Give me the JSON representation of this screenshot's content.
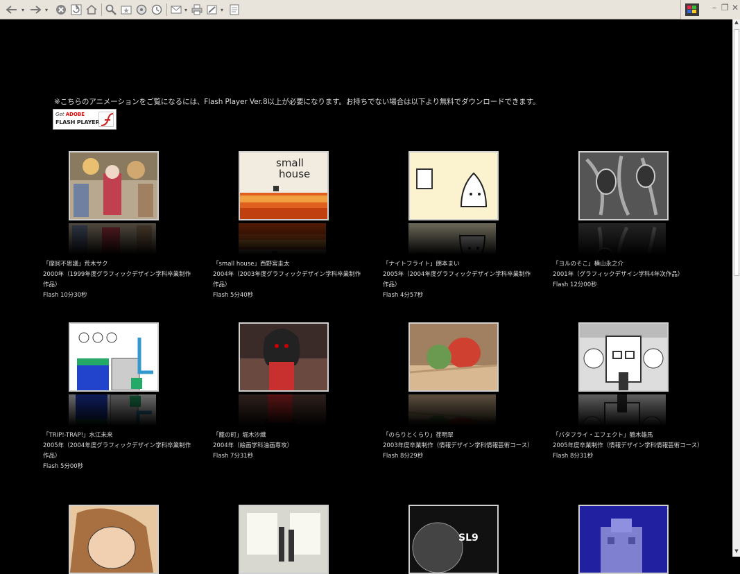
{
  "notice_text": "※こちらのアニメーションをご覧になるには、Flash Player Ver.8以上が必要になります。お持ちでない場合は以下より無料でダウンロードできます。",
  "flash_badge": {
    "get": "Get",
    "adobe": "ADOBE",
    "product": "FLASH PLAYER"
  },
  "items": [
    {
      "title": "「摩訶不思議」荒木サク",
      "year": "2000年（1999年度グラフィックデザイン学科卒業制作作品）",
      "duration": "Flash 10分30秒"
    },
    {
      "title": "「small house」西野宮圭太",
      "year": "2004年（2003年度グラフィックデザイン学科卒業制作作品）",
      "duration": "Flash 5分40秒",
      "thumb_text": "small\nhouse"
    },
    {
      "title": "「ナイトフライト」朗本まい",
      "year": "2005年（2004年度グラフィックデザイン学科卒業制作作品）",
      "duration": "Flash 4分57秒"
    },
    {
      "title": "「ヨルのそこ」横山永之介",
      "year": "2001年（グラフィックデザイン学科4年次作品）",
      "duration": "Flash 12分00秒"
    },
    {
      "title": "「TRIP!-TRAP!」水江未来",
      "year": "2005年（2004年度グラフィックデザイン学科卒業制作作品）",
      "duration": "Flash 5分00秒"
    },
    {
      "title": "「籠の町」堀木沙織",
      "year": "2004年（絵画学科油画専攻）",
      "duration": "Flash 7分31秒"
    },
    {
      "title": "「のらりとくらり」荏明翠",
      "year": "2003年度卒業制作（情報デザイン学科情報芸術コース）",
      "duration": "Flash 8分29秒"
    },
    {
      "title": "「バタフライ・エフェクト」鶴木雄馬",
      "year": "2005年度卒業制作（情報デザイン学科情報芸術コース）",
      "duration": "Flash 8分31秒"
    },
    {},
    {},
    {
      "thumb_text": "SL9"
    },
    {}
  ],
  "colors": {
    "background": "#000000",
    "text": "#dddddd",
    "toolbar": "#e8e4dc"
  }
}
